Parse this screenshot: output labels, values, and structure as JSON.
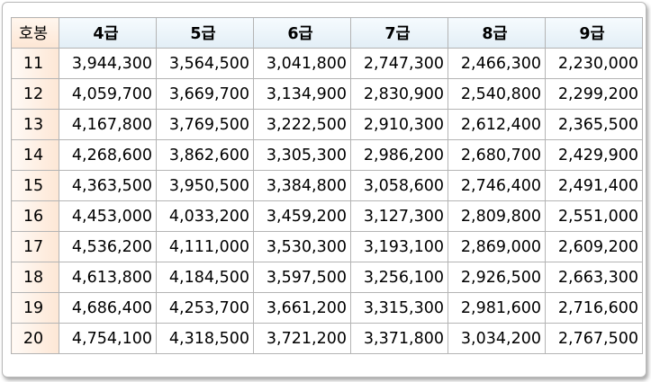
{
  "table": {
    "corner": "호봉",
    "columns": [
      "4급",
      "5급",
      "6급",
      "7급",
      "8급",
      "9급"
    ],
    "rows": [
      {
        "step": "11",
        "values": [
          "3,944,300",
          "3,564,500",
          "3,041,800",
          "2,747,300",
          "2,466,300",
          "2,230,000"
        ]
      },
      {
        "step": "12",
        "values": [
          "4,059,700",
          "3,669,700",
          "3,134,900",
          "2,830,900",
          "2,540,800",
          "2,299,200"
        ]
      },
      {
        "step": "13",
        "values": [
          "4,167,800",
          "3,769,500",
          "3,222,500",
          "2,910,300",
          "2,612,400",
          "2,365,500"
        ]
      },
      {
        "step": "14",
        "values": [
          "4,268,600",
          "3,862,600",
          "3,305,300",
          "2,986,200",
          "2,680,700",
          "2,429,900"
        ]
      },
      {
        "step": "15",
        "values": [
          "4,363,500",
          "3,950,500",
          "3,384,800",
          "3,058,600",
          "2,746,400",
          "2,491,400"
        ]
      },
      {
        "step": "16",
        "values": [
          "4,453,000",
          "4,033,200",
          "3,459,200",
          "3,127,300",
          "2,809,800",
          "2,551,000"
        ]
      },
      {
        "step": "17",
        "values": [
          "4,536,200",
          "4,111,000",
          "3,530,300",
          "3,193,100",
          "2,869,000",
          "2,609,200"
        ]
      },
      {
        "step": "18",
        "values": [
          "4,613,800",
          "4,184,500",
          "3,597,500",
          "3,256,100",
          "2,926,500",
          "2,663,300"
        ]
      },
      {
        "step": "19",
        "values": [
          "4,686,400",
          "4,253,700",
          "3,661,200",
          "3,315,300",
          "2,981,600",
          "2,716,600"
        ]
      },
      {
        "step": "20",
        "values": [
          "4,754,100",
          "4,318,500",
          "3,721,200",
          "3,371,800",
          "3,034,200",
          "2,767,500"
        ]
      }
    ]
  }
}
